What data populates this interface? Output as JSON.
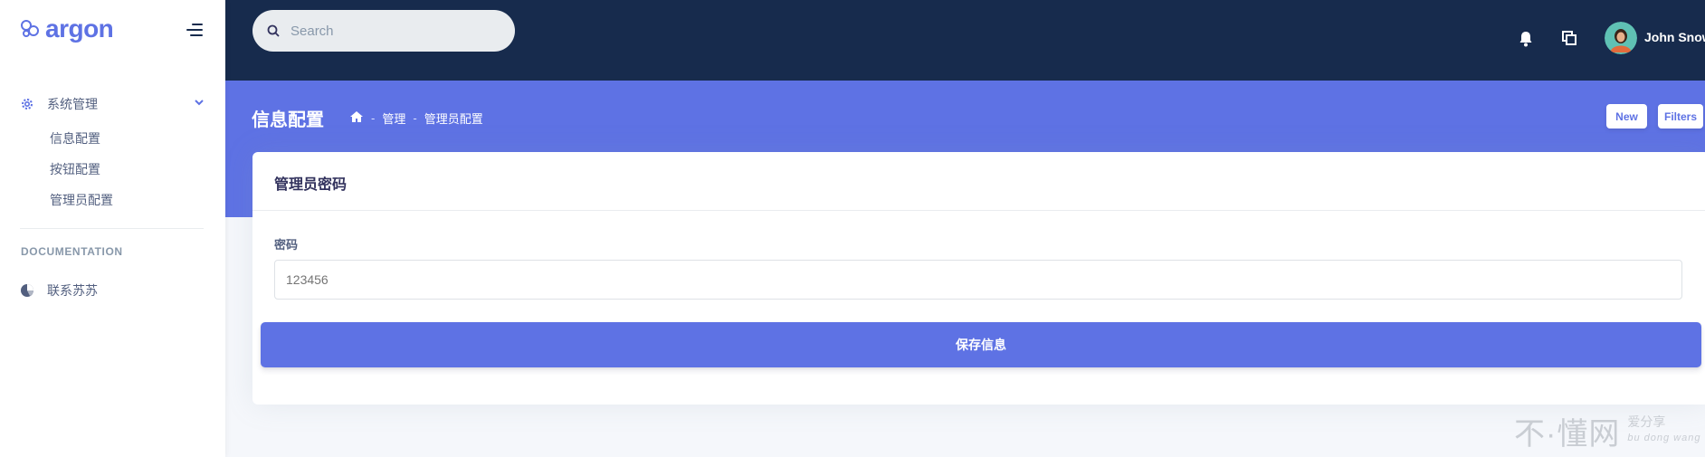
{
  "brand": {
    "name": "argon"
  },
  "sidebar": {
    "parent": {
      "label": "系统管理"
    },
    "children": [
      {
        "label": "信息配置"
      },
      {
        "label": "按钮配置"
      },
      {
        "label": "管理员配置"
      }
    ],
    "section_heading": "DOCUMENTATION",
    "doc_link": {
      "label": "联系苏苏"
    }
  },
  "topbar": {
    "search_placeholder": "Search",
    "user_name": "John Snow"
  },
  "header": {
    "page_title": "信息配置",
    "breadcrumb": [
      "管理",
      "管理员配置"
    ],
    "new_label": "New",
    "filters_label": "Filters"
  },
  "card": {
    "title": "管理员密码",
    "field_label": "密码",
    "field_placeholder": "123456",
    "save_label": "保存信息"
  },
  "watermark": {
    "main": "不·懂网",
    "side_top": "爱分享",
    "side_bottom": "bu dong wang"
  },
  "colors": {
    "primary": "#5e72e4",
    "navy": "#172b4d",
    "background": "#f5f7fb"
  }
}
